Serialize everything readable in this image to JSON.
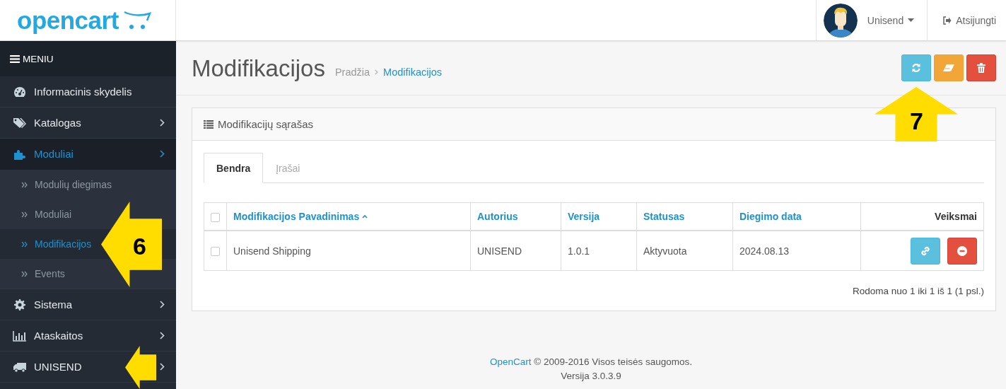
{
  "header": {
    "logo": "opencart",
    "user_name": "Unisend",
    "logout": "Atsijungti"
  },
  "sidebar": {
    "title": "MENIU",
    "items": [
      {
        "label": "Informacinis skydelis",
        "selected": false,
        "submenu": false,
        "expanded": false
      },
      {
        "label": "Katalogas",
        "selected": false,
        "submenu": true,
        "expanded": false
      },
      {
        "label": "Moduliai",
        "selected": true,
        "submenu": true,
        "expanded": true,
        "children": [
          {
            "label": "Modulių diegimas",
            "selected": false
          },
          {
            "label": "Moduliai",
            "selected": false
          },
          {
            "label": "Modifikacijos",
            "selected": true
          },
          {
            "label": "Events",
            "selected": false
          }
        ]
      },
      {
        "label": "Sistema",
        "selected": false,
        "submenu": true,
        "expanded": false
      },
      {
        "label": "Ataskaitos",
        "selected": false,
        "submenu": true,
        "expanded": false
      },
      {
        "label": "UNISEND",
        "selected": false,
        "submenu": true,
        "expanded": false
      }
    ]
  },
  "page": {
    "title": "Modifikacijos",
    "breadcrumbs": [
      {
        "label": "Pradžia",
        "selected": false
      },
      {
        "label": "Modifikacijos",
        "selected": true
      }
    ]
  },
  "panel": {
    "title": "Modifikacijų sąrašas",
    "tabs": [
      {
        "label": "Bendra",
        "selected": true
      },
      {
        "label": "Įrašai",
        "selected": false
      }
    ],
    "table": {
      "select_all": {
        "checked": false
      },
      "columns": [
        {
          "label": "Modifikacijos Pavadinimas",
          "kind": "link",
          "sorted": true
        },
        {
          "label": "Autorius",
          "kind": "link",
          "sorted": false
        },
        {
          "label": "Versija",
          "kind": "link",
          "sorted": false
        },
        {
          "label": "Statusas",
          "kind": "link",
          "sorted": false
        },
        {
          "label": "Diegimo data",
          "kind": "link",
          "sorted": false
        },
        {
          "label": "Veiksmai",
          "kind": "plain",
          "sorted": false
        }
      ],
      "rows": [
        {
          "checked": false,
          "cells": [
            "Unisend Shipping",
            "UNISEND",
            "1.0.1",
            "Aktyvuota",
            "2024.08.13"
          ]
        }
      ]
    },
    "pagination": "Rodoma nuo 1 iki 1 iš 1 (1 psl.)"
  },
  "footer": {
    "link": "OpenCart",
    "text": " © 2009-2016 Visos teisės saugomos.",
    "version": "Versija 3.0.3.9"
  },
  "annotations": [
    {
      "kind": "arrow-left",
      "label": "6"
    },
    {
      "kind": "arrow-up",
      "label": "7"
    },
    {
      "kind": "arrow-left"
    }
  ]
}
